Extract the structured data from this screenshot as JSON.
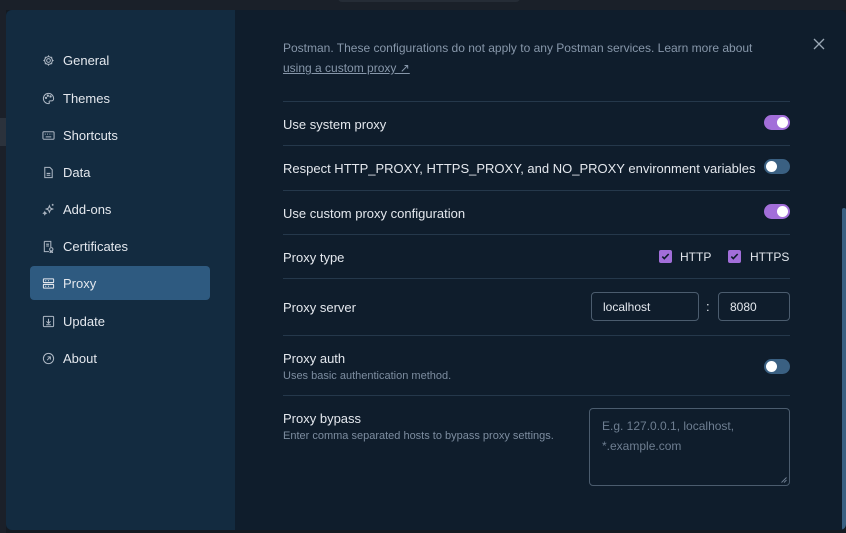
{
  "sidebar": {
    "items": [
      {
        "label": "General",
        "icon": "gear-icon"
      },
      {
        "label": "Themes",
        "icon": "palette-icon"
      },
      {
        "label": "Shortcuts",
        "icon": "keyboard-icon"
      },
      {
        "label": "Data",
        "icon": "data-icon"
      },
      {
        "label": "Add-ons",
        "icon": "sparkle-icon"
      },
      {
        "label": "Certificates",
        "icon": "certificate-icon"
      },
      {
        "label": "Proxy",
        "icon": "proxy-icon"
      },
      {
        "label": "Update",
        "icon": "download-icon"
      },
      {
        "label": "About",
        "icon": "info-icon"
      }
    ],
    "active": "Proxy"
  },
  "intro": {
    "text": "Postman. These configurations do not apply to any Postman services. Learn more about",
    "link": "using a custom proxy ↗"
  },
  "settings": {
    "system_proxy": {
      "label": "Use system proxy",
      "enabled": true
    },
    "respect_env": {
      "label": "Respect HTTP_PROXY, HTTPS_PROXY, and NO_PROXY environment variables",
      "enabled": false
    },
    "custom_proxy": {
      "label": "Use custom proxy configuration",
      "enabled": true
    },
    "proxy_type": {
      "label": "Proxy type",
      "http_label": "HTTP",
      "https_label": "HTTPS",
      "http_checked": true,
      "https_checked": true
    },
    "proxy_server": {
      "label": "Proxy server",
      "host": "localhost",
      "separator": ":",
      "port": "8080"
    },
    "proxy_auth": {
      "label": "Proxy auth",
      "description": "Uses basic authentication method.",
      "enabled": false
    },
    "proxy_bypass": {
      "label": "Proxy bypass",
      "description": "Enter comma separated hosts to bypass proxy settings.",
      "placeholder": "E.g. 127.0.0.1, localhost, *.example.com"
    }
  },
  "colors": {
    "accent": "#a26ed9",
    "active_nav": "#2e5a80",
    "sidebar_bg": "#132b40",
    "content_bg": "#0f1d2c",
    "toggle_off": "#3a6082"
  }
}
